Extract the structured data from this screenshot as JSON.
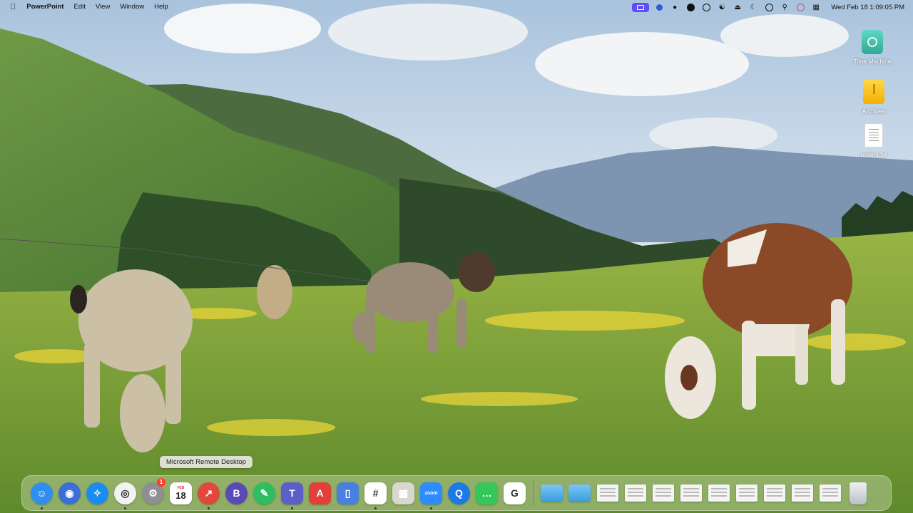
{
  "menubar": {
    "apple_icon": "apple-logo-icon",
    "app_name": "PowerPoint",
    "menus": [
      "Edit",
      "View",
      "Window",
      "Help"
    ],
    "status_icons": [
      "screen-share-icon",
      "zoom-icon",
      "evernote-icon",
      "accessibility-icon",
      "clock-icon",
      "wifi-icon",
      "eject-icon",
      "moon-icon",
      "play-icon",
      "search-icon",
      "siri-icon",
      "control-center-icon"
    ],
    "clock": "Wed Feb 18  1:09:05 PM"
  },
  "desktop": {
    "icons": [
      {
        "label": "Time Machine",
        "icon": "time-machine-icon"
      },
      {
        "label": "Archives",
        "icon": "archive-icon"
      },
      {
        "label": "boilers.txt",
        "icon": "text-file-icon"
      }
    ]
  },
  "tooltip": {
    "text": "Microsoft Remote Desktop"
  },
  "dock": {
    "apps": [
      {
        "name": "Finder",
        "icon": "finder-icon",
        "color": "#2f8ef0",
        "glyph": "☺",
        "running": true
      },
      {
        "name": "Firefox",
        "icon": "firefox-icon",
        "color": "#3b6fd8",
        "glyph": "◉",
        "running": false
      },
      {
        "name": "Safari",
        "icon": "safari-icon",
        "color": "#1a8cf0",
        "glyph": "✧",
        "running": false
      },
      {
        "name": "Chrome",
        "icon": "chrome-icon",
        "color": "#f2f2f2",
        "glyph": "◎",
        "running": true
      },
      {
        "name": "System Settings",
        "icon": "settings-icon",
        "color": "#8e8e93",
        "glyph": "⚙",
        "running": false,
        "badge": "1"
      },
      {
        "name": "Calendar",
        "icon": "calendar-icon",
        "color": "#ffffff",
        "glyph": "18",
        "running": false
      },
      {
        "name": "Microsoft Remote Desktop",
        "icon": "remote-desktop-icon",
        "color": "#e2473b",
        "glyph": "↗",
        "running": true
      },
      {
        "name": "BBEdit",
        "icon": "bbedit-icon",
        "color": "#5a4ab8",
        "glyph": "B",
        "running": false
      },
      {
        "name": "Evernote",
        "icon": "evernote-icon",
        "color": "#2dbe60",
        "glyph": "✎",
        "running": false
      },
      {
        "name": "Teams",
        "icon": "teams-icon",
        "color": "#5b5fc7",
        "glyph": "T",
        "running": true
      },
      {
        "name": "Acrobat",
        "icon": "acrobat-icon",
        "color": "#e0403a",
        "glyph": "A",
        "running": false
      },
      {
        "name": "Simulator",
        "icon": "phone-icon",
        "color": "#4a7fe0",
        "glyph": "▯",
        "running": false
      },
      {
        "name": "Slack",
        "icon": "slack-icon",
        "color": "#ffffff",
        "glyph": "#",
        "running": true
      },
      {
        "name": "Preview",
        "icon": "preview-icon",
        "color": "#d8d8d0",
        "glyph": "▦",
        "running": false
      },
      {
        "name": "Zoom",
        "icon": "zoom-icon",
        "color": "#2d8cff",
        "glyph": "zoom",
        "running": true
      },
      {
        "name": "QuickTime",
        "icon": "quicktime-icon",
        "color": "#1b7ae8",
        "glyph": "Q",
        "running": false
      },
      {
        "name": "Messages",
        "icon": "messages-icon",
        "color": "#35c759",
        "glyph": "…",
        "running": false
      },
      {
        "name": "Grammarly",
        "icon": "grammarly-icon",
        "color": "#ffffff",
        "glyph": "G",
        "running": false
      }
    ],
    "stack_items": [
      {
        "name": "Applications",
        "icon": "app-folder-icon",
        "kind": "folder"
      },
      {
        "name": "Downloads",
        "icon": "downloads-folder-icon",
        "kind": "folder"
      },
      {
        "name": "Document 1",
        "icon": "document-thumb-icon",
        "kind": "doc"
      },
      {
        "name": "Document 2",
        "icon": "document-thumb-icon",
        "kind": "doc"
      },
      {
        "name": "Document 3",
        "icon": "document-thumb-icon",
        "kind": "doc"
      },
      {
        "name": "Document 4",
        "icon": "document-thumb-icon",
        "kind": "doc"
      },
      {
        "name": "Document 5",
        "icon": "document-thumb-icon",
        "kind": "doc"
      },
      {
        "name": "Document 6",
        "icon": "document-thumb-icon",
        "kind": "doc"
      },
      {
        "name": "Document 7",
        "icon": "document-thumb-icon",
        "kind": "doc"
      },
      {
        "name": "Document 8",
        "icon": "document-thumb-icon",
        "kind": "doc"
      },
      {
        "name": "Document 9",
        "icon": "document-thumb-icon",
        "kind": "doc"
      },
      {
        "name": "Trash",
        "icon": "trash-icon",
        "kind": "trash"
      }
    ]
  }
}
